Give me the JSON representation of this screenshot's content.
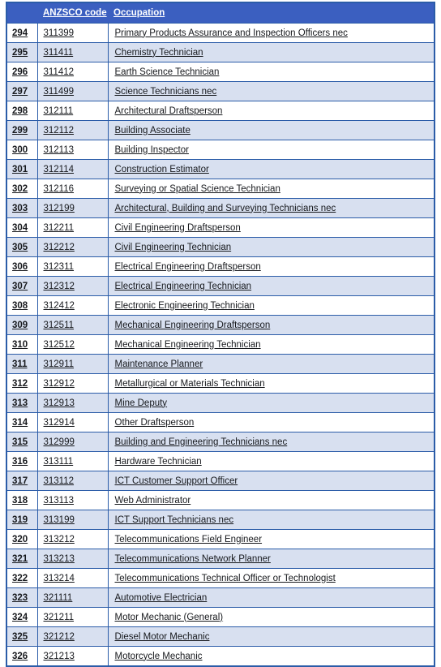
{
  "table": {
    "columns": [
      {
        "key": "index",
        "label": ""
      },
      {
        "key": "code",
        "label": "ANZSCO code"
      },
      {
        "key": "occupation",
        "label": "Occupation"
      }
    ],
    "header_background": "#3B5FC0",
    "header_text_color": "#FFFFFF",
    "border_color": "#2B5CA8",
    "row_tint_color": "#D8E0F0",
    "row_plain_color": "#FFFFFF",
    "rows": [
      {
        "index": "294",
        "code": "311399",
        "occupation": "Primary Products Assurance and Inspection Officers nec"
      },
      {
        "index": "295",
        "code": "311411",
        "occupation": "Chemistry Technician"
      },
      {
        "index": "296",
        "code": "311412",
        "occupation": "Earth Science Technician"
      },
      {
        "index": "297",
        "code": "311499",
        "occupation": "Science Technicians nec"
      },
      {
        "index": "298",
        "code": "312111",
        "occupation": "Architectural Draftsperson"
      },
      {
        "index": "299",
        "code": "312112",
        "occupation": "Building Associate"
      },
      {
        "index": "300",
        "code": "312113",
        "occupation": "Building Inspector"
      },
      {
        "index": "301",
        "code": "312114",
        "occupation": "Construction Estimator"
      },
      {
        "index": "302",
        "code": "312116",
        "occupation": "Surveying or Spatial Science Technician"
      },
      {
        "index": "303",
        "code": "312199",
        "occupation": "Architectural, Building and Surveying Technicians nec"
      },
      {
        "index": "304",
        "code": "312211",
        "occupation": "Civil Engineering Draftsperson"
      },
      {
        "index": "305",
        "code": "312212",
        "occupation": "Civil Engineering Technician"
      },
      {
        "index": "306",
        "code": "312311",
        "occupation": "Electrical Engineering Draftsperson"
      },
      {
        "index": "307",
        "code": "312312",
        "occupation": "Electrical Engineering Technician"
      },
      {
        "index": "308",
        "code": "312412",
        "occupation": "Electronic Engineering Technician"
      },
      {
        "index": "309",
        "code": "312511",
        "occupation": "Mechanical Engineering Draftsperson"
      },
      {
        "index": "310",
        "code": "312512",
        "occupation": "Mechanical Engineering Technician"
      },
      {
        "index": "311",
        "code": "312911",
        "occupation": "Maintenance Planner"
      },
      {
        "index": "312",
        "code": "312912",
        "occupation": "Metallurgical or Materials Technician"
      },
      {
        "index": "313",
        "code": "312913",
        "occupation": "Mine Deputy"
      },
      {
        "index": "314",
        "code": "312914",
        "occupation": "Other Draftsperson"
      },
      {
        "index": "315",
        "code": "312999",
        "occupation": "Building and Engineering Technicians nec"
      },
      {
        "index": "316",
        "code": "313111",
        "occupation": "Hardware Technician"
      },
      {
        "index": "317",
        "code": "313112",
        "occupation": "ICT Customer Support Officer"
      },
      {
        "index": "318",
        "code": "313113",
        "occupation": "Web Administrator"
      },
      {
        "index": "319",
        "code": "313199",
        "occupation": "ICT Support Technicians nec"
      },
      {
        "index": "320",
        "code": "313212",
        "occupation": "Telecommunications Field Engineer"
      },
      {
        "index": "321",
        "code": "313213",
        "occupation": "Telecommunications Network Planner"
      },
      {
        "index": "322",
        "code": "313214",
        "occupation": "Telecommunications Technical Officer or Technologist"
      },
      {
        "index": "323",
        "code": "321111",
        "occupation": "Automotive Electrician"
      },
      {
        "index": "324",
        "code": "321211",
        "occupation": "Motor Mechanic (General)"
      },
      {
        "index": "325",
        "code": "321212",
        "occupation": "Diesel Motor Mechanic"
      },
      {
        "index": "326",
        "code": "321213",
        "occupation": "Motorcycle Mechanic"
      }
    ]
  }
}
